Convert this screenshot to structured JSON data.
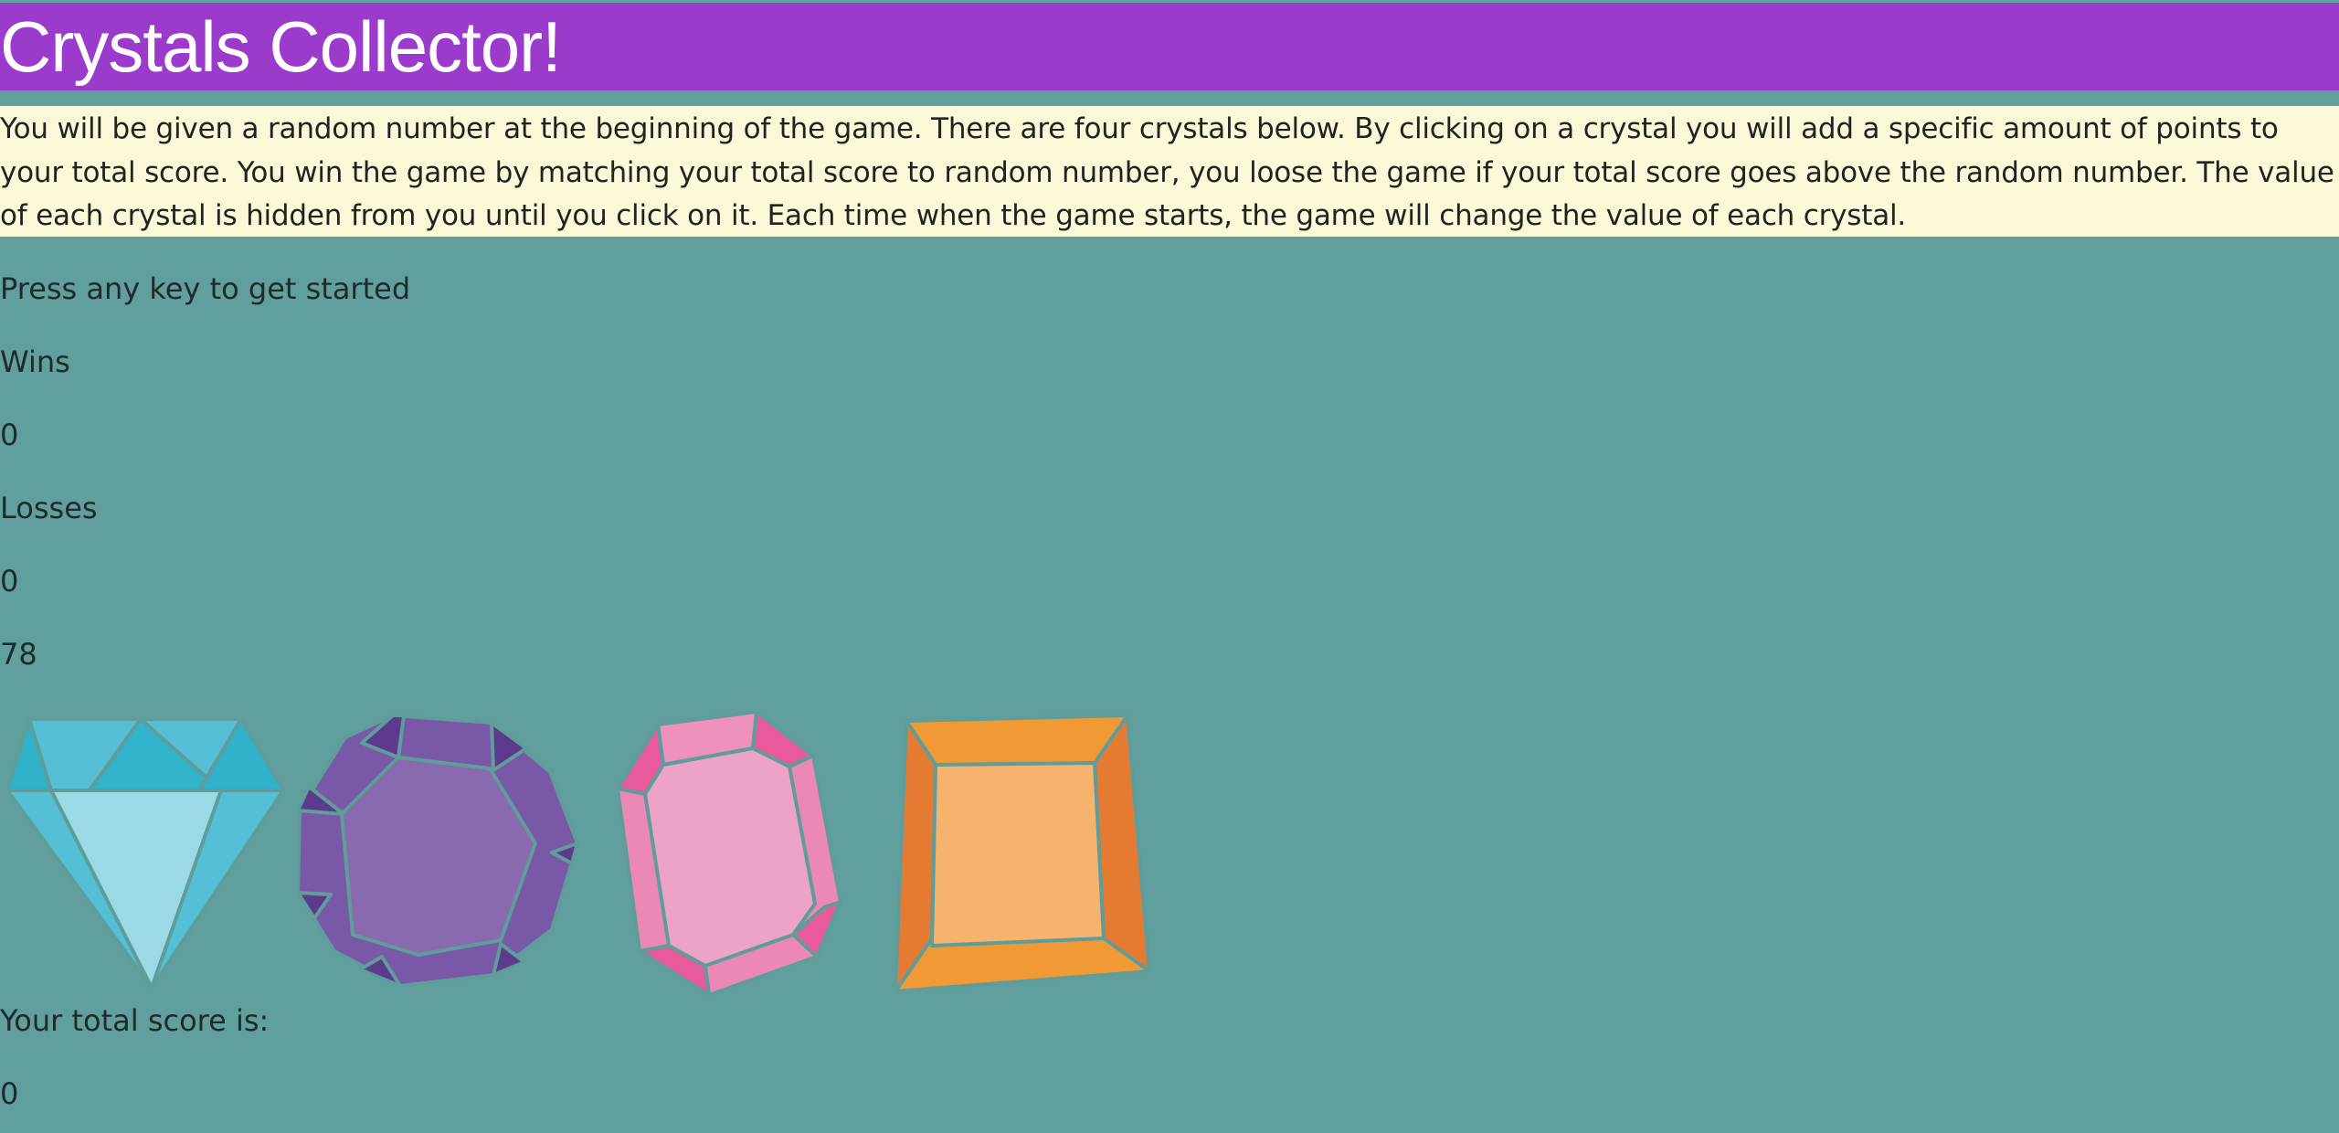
{
  "header": {
    "title": "Crystals Collector!"
  },
  "instructions": {
    "text": "You will be given a random number at the beginning of the game. There are four crystals below. By clicking on a crystal you will add a specific amount of points to your total score. You win the game by matching your total score to random number, you loose the game if your total score goes above the random number. The value of each crystal is hidden from you until you click on it. Each time when the game starts, the game will change the value of each crystal."
  },
  "game": {
    "prompt": "Press any key to get started",
    "wins_label": "Wins",
    "wins_value": "0",
    "losses_label": "Losses",
    "losses_value": "0",
    "target_number": "78",
    "score_label": "Your total score is:",
    "score_value": "0"
  },
  "crystals": [
    {
      "name": "blue-diamond-crystal",
      "color": "#5bc3d6"
    },
    {
      "name": "purple-octagon-crystal",
      "color": "#8a6aae"
    },
    {
      "name": "pink-emerald-crystal",
      "color": "#eca3c7"
    },
    {
      "name": "orange-square-crystal",
      "color": "#f2a24a"
    }
  ],
  "colors": {
    "background": "#619f9f",
    "header": "#9a3bcc",
    "instructions_bg": "#fbf8d7"
  }
}
